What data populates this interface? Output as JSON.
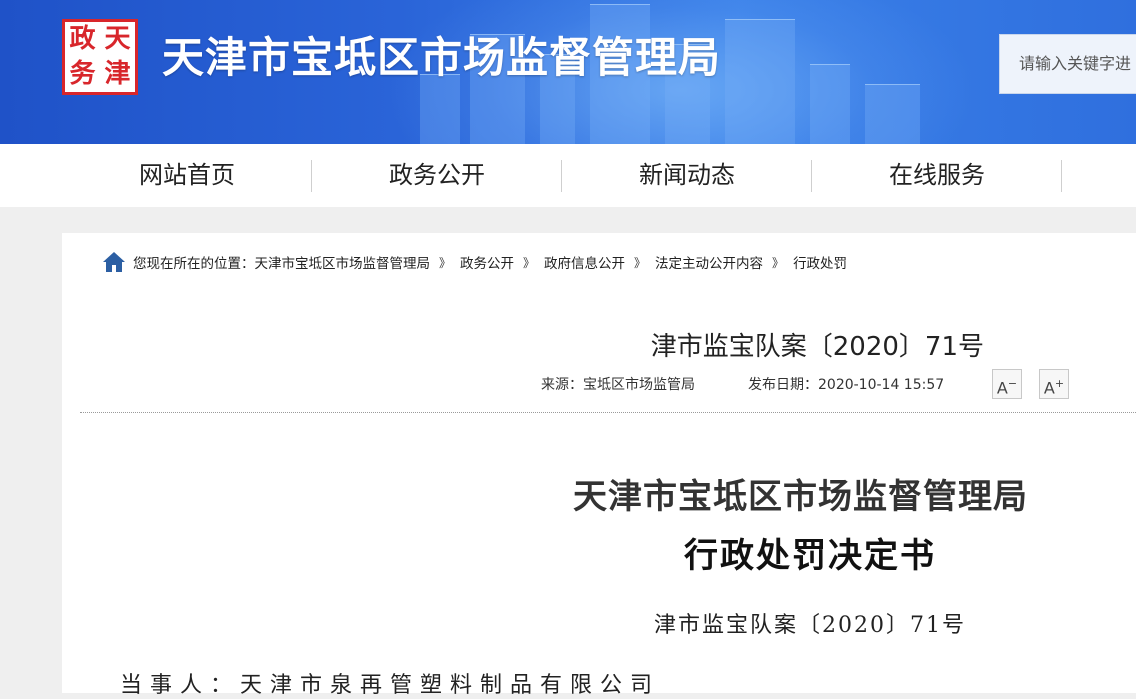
{
  "header": {
    "logo_chars": [
      "政",
      "天",
      "务",
      "津"
    ],
    "site_title": "天津市宝坻区市场监督管理局",
    "search_placeholder": "请输入关键字进"
  },
  "nav": {
    "items": [
      "网站首页",
      "政务公开",
      "新闻动态",
      "在线服务"
    ]
  },
  "breadcrumb": {
    "prefix": "您现在所在的位置：",
    "items": [
      "天津市宝坻区市场监督管理局",
      "政务公开",
      "政府信息公开",
      "法定主动公开内容",
      "行政处罚"
    ],
    "separator": "》"
  },
  "article": {
    "doc_number": "津市监宝队案〔2020〕71号",
    "source": "来源：宝坻区市场监管局",
    "publish_date": "发布日期：2020-10-14 15:57",
    "font_smaller": "A",
    "font_larger": "A",
    "body_title_1": "天津市宝坻区市场监督管理局",
    "body_title_2": "行政处罚决定书",
    "body_doc_number": "津市监宝队案〔2020〕71号",
    "body_first_line": "当事人：天津市泉再管塑料制品有限公司"
  },
  "colors": {
    "header_blue": "#2a64d8",
    "logo_red": "#d8262b"
  }
}
